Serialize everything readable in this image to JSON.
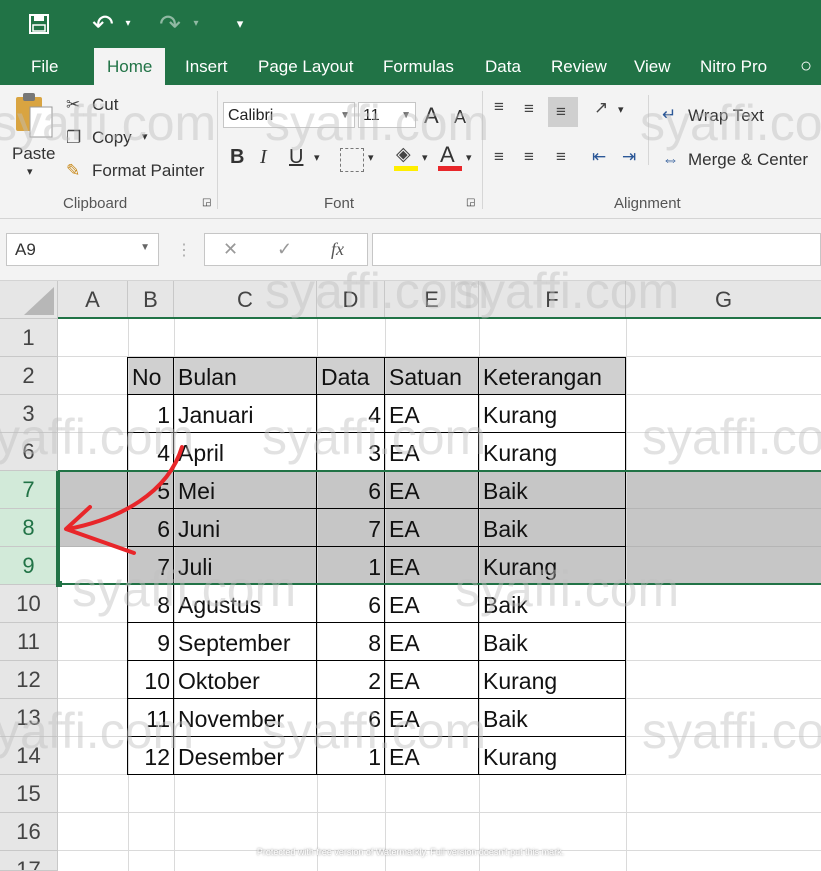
{
  "quick_access": {
    "undo_label": "↶",
    "redo_label": "↷",
    "customize_label": "▾"
  },
  "tabs": [
    "File",
    "Home",
    "Insert",
    "Page Layout",
    "Formulas",
    "Data",
    "Review",
    "View",
    "Nitro Pro"
  ],
  "ribbon": {
    "clipboard": {
      "paste": "Paste",
      "cut": "Cut",
      "copy": "Copy",
      "format_painter": "Format Painter",
      "label": "Clipboard"
    },
    "font": {
      "family": "Calibri",
      "size": "11",
      "bold": "B",
      "italic": "I",
      "underline": "U",
      "label": "Font"
    },
    "alignment": {
      "wrap_text": "Wrap Text",
      "merge_center": "Merge & Center",
      "label": "Alignment"
    }
  },
  "formula_bar": {
    "name_box": "A9",
    "fx": "fx",
    "cancel": "✕",
    "enter": "✓",
    "content": ""
  },
  "columns": [
    "A",
    "B",
    "C",
    "D",
    "E",
    "F",
    "G"
  ],
  "rows": [
    "1",
    "2",
    "3",
    "6",
    "7",
    "8",
    "9",
    "10",
    "11",
    "12",
    "13",
    "14",
    "15",
    "16",
    "17"
  ],
  "table": {
    "headers": [
      "No",
      "Bulan",
      "Data",
      "Satuan",
      "Keterangan"
    ],
    "rows": [
      [
        "1",
        "Januari",
        "4",
        "EA",
        "Kurang"
      ],
      [
        "4",
        "April",
        "3",
        "EA",
        "Kurang"
      ],
      [
        "5",
        "Mei",
        "6",
        "EA",
        "Baik"
      ],
      [
        "6",
        "Juni",
        "7",
        "EA",
        "Baik"
      ],
      [
        "7",
        "Juli",
        "1",
        "EA",
        "Kurang"
      ],
      [
        "8",
        "Agustus",
        "6",
        "EA",
        "Baik"
      ],
      [
        "9",
        "September",
        "8",
        "EA",
        "Baik"
      ],
      [
        "10",
        "Oktober",
        "2",
        "EA",
        "Kurang"
      ],
      [
        "11",
        "November",
        "6",
        "EA",
        "Baik"
      ],
      [
        "12",
        "Desember",
        "1",
        "EA",
        "Kurang"
      ]
    ]
  },
  "watermark": "syaffi.com",
  "footer_note": "Protected with free version of Watermarkly. Full version doesn't put this mark.",
  "colors": {
    "accent": "#217346",
    "selection": "#c6c6c6",
    "arrow": "#e8262a"
  }
}
